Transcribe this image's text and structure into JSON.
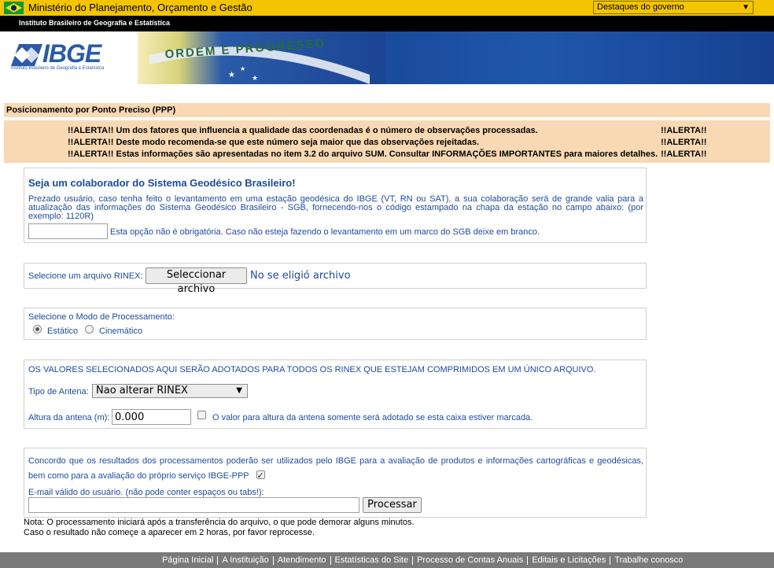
{
  "govbar": {
    "ministry": "Ministério do Planejamento, Orçamento e Gestão",
    "dropdown": "Destaques do governo"
  },
  "institute_bar": "Instituto Brasileiro de Geografia e Estatística",
  "logo": {
    "text": "IBGE",
    "subtitle": "Instituto Brasileiro de Geografia e Estatística",
    "motto": "ORDEM E PROGRESSO"
  },
  "page_title": "Posicionamento por Ponto Preciso (PPP)",
  "alerts": [
    "!!ALERTA!! Um dos fatores que influencia a qualidade das coordenadas é o número de observações processadas.",
    "!!ALERTA!! Deste modo recomenda-se que este número seja maior que das observações rejeitadas.",
    "!!ALERTA!! Estas informações são apresentadas no item 3.2 do arquivo SUM. Consultar INFORMAÇÕES IMPORTANTES para maiores detalhes."
  ],
  "alert_tag": "!!ALERTA!!",
  "collaborator": {
    "title": "Seja um colaborador do Sistema Geodésico Brasileiro!",
    "description": "Prezado usuário, caso tenha feito o levantamento em uma estação geodésica do IBGE (VT, RN ou SAT), a sua colaboração será de grande valia para a atualização das informações do Sistema Geodésico Brasileiro - SGB, fornecendo-nos o código estampado na chapa da estação no campo abaixo: (por exemplo: 1120R)",
    "input_value": "",
    "hint": "Esta opção não é obrigatória. Caso não esteja fazendo o levantamento em um marco do SGB deixe em branco."
  },
  "rinex": {
    "label": "Selecione um arquivo RINEX:",
    "button": "Seleccionar archivo",
    "status": "No se eligió archivo"
  },
  "mode": {
    "label": "Selecione o Modo de Processamento:",
    "options": [
      "Estático",
      "Cinemático"
    ],
    "selected": "Estático"
  },
  "antenna": {
    "notice": "OS VALORES SELECIONADOS AQUI SERÃO ADOTADOS PARA TODOS OS RINEX QUE ESTEJAM COMPRIMIDOS EM UM ÚNICO ARQUIVO.",
    "type_label": "Tipo de Antena:",
    "type_value": "Nao alterar RINEX",
    "height_label": "Altura da antena (m):",
    "height_value": "0.000",
    "height_checked": false,
    "height_hint": "O valor para altura da antena somente será adotado se esta caixa estiver marcada."
  },
  "consent": {
    "text": "Concordo que os resultados dos processamentos poderão ser utilizados pelo IBGE para a avaliação de produtos e informações cartográficas e geodésicas, bem como para a avaliação do próprio serviço IBGE-PPP",
    "checked": true,
    "email_label": "E-mail válido do usuário. (não pode conter espaços ou tabs!):",
    "email_value": "",
    "submit": "Processar"
  },
  "notes": [
    "Nota: O processamento iniciará após a transferência do arquivo, o que pode demorar alguns minutos.",
    "Caso o resultado não começe a aparecer em 2 horas, por favor reprocesse."
  ],
  "footer": [
    "Página Inicial",
    "A Instituição",
    "Atendimento",
    "Estatísticas do Site",
    "Processo de Contas Anuais",
    "Editais e Licitações",
    "Trabalhe conosco"
  ]
}
